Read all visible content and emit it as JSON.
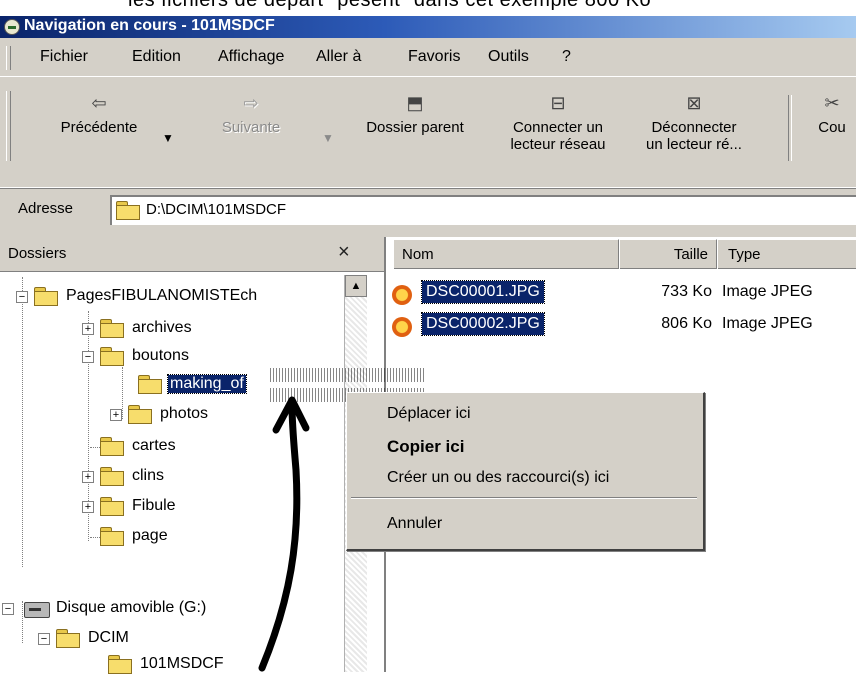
{
  "caption": "les fichiers de départ \"pèsent\" dans cet exemple 800 Ko",
  "window": {
    "title": "Navigation en cours - 101MSDCF"
  },
  "menu": [
    "Fichier",
    "Edition",
    "Affichage",
    "Aller à",
    "Favoris",
    "Outils",
    "?"
  ],
  "toolbar": {
    "back": "Précédente",
    "forward": "Suivante",
    "up": "Dossier parent",
    "map_drive_line1": "Connecter un",
    "map_drive_line2": "lecteur réseau",
    "disconnect_line1": "Déconnecter",
    "disconnect_line2": "un lecteur ré...",
    "cut": "Cou"
  },
  "address": {
    "label": "Adresse",
    "value": "D:\\DCIM\\101MSDCF"
  },
  "folders_pane": {
    "title": "Dossiers",
    "close": "×",
    "items": [
      {
        "label": "PagesFIBULANOMISTEch",
        "expander": "−"
      },
      {
        "label": "archives",
        "expander": "+"
      },
      {
        "label": "boutons",
        "expander": "−"
      },
      {
        "label": "making_of",
        "expander": ""
      },
      {
        "label": "photos",
        "expander": "+"
      },
      {
        "label": "cartes",
        "expander": ""
      },
      {
        "label": "clins",
        "expander": "+"
      },
      {
        "label": "Fibule",
        "expander": "+"
      },
      {
        "label": "page",
        "expander": ""
      },
      {
        "label": "Disque amovible (G:)",
        "expander": "−"
      },
      {
        "label": "DCIM",
        "expander": "−"
      },
      {
        "label": "101MSDCF",
        "expander": ""
      }
    ]
  },
  "files": {
    "columns": [
      "Nom",
      "Taille",
      "Type"
    ],
    "rows": [
      {
        "name": "DSC00001.JPG",
        "size": "733 Ko",
        "type": "Image JPEG"
      },
      {
        "name": "DSC00002.JPG",
        "size": "806 Ko",
        "type": "Image JPEG"
      }
    ]
  },
  "context_menu": {
    "move": "Déplacer ici",
    "copy": "Copier ici",
    "shortcut": "Créer un ou des raccourci(s) ici",
    "cancel": "Annuler"
  },
  "colors": {
    "selection": "#0a246a",
    "chrome": "#d4d0c8",
    "titlebar": "#0a246a"
  },
  "icons": [
    "folder-icon",
    "drive-icon",
    "jpeg-file-icon",
    "back-arrow-icon",
    "forward-arrow-icon",
    "folder-up-icon",
    "map-drive-icon",
    "disconnect-drive-icon",
    "close-icon"
  ]
}
